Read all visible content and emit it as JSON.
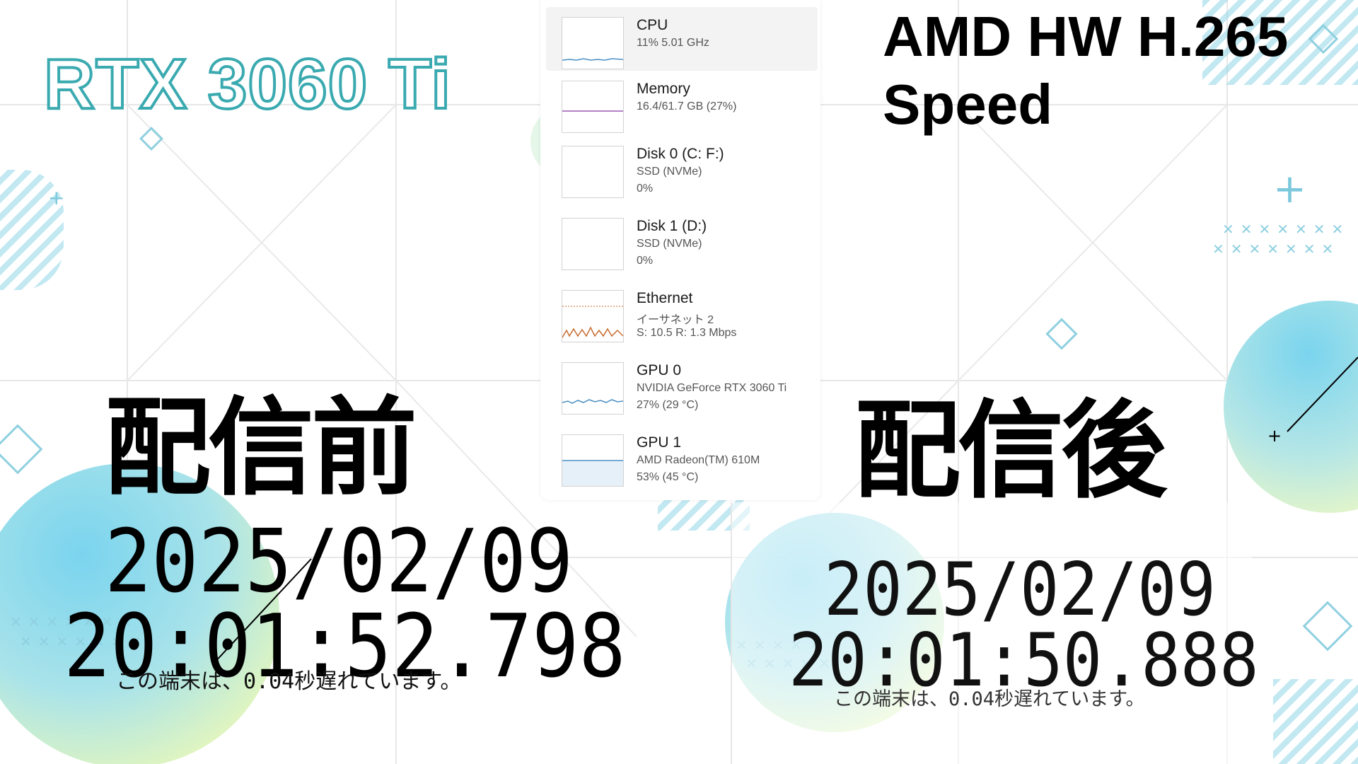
{
  "left_panel": {
    "gpu_title": "RTX 3060 Ti",
    "state_label": "配信前",
    "date": "2025/02/09",
    "time": "20:01:52.798",
    "delay_text": "この端末は、0.04秒遅れています。"
  },
  "right_panel": {
    "encoder_title_line1": "AMD HW H.265",
    "encoder_title_line2": "Speed",
    "state_label": "配信後",
    "date": "2025/02/09",
    "time": "20:01:50.888",
    "delay_text": "この端末は、0.04秒遅れています。"
  },
  "task_manager": {
    "items": [
      {
        "name": "CPU",
        "line1": "11%  5.01 GHz",
        "line2": "",
        "selected": true,
        "graph_color": "#4a8fc4"
      },
      {
        "name": "Memory",
        "line1": "16.4/61.7 GB (27%)",
        "line2": "",
        "selected": false,
        "graph_color": "#9b59b6"
      },
      {
        "name": "Disk 0 (C: F:)",
        "line1": "SSD (NVMe)",
        "line2": "0%",
        "selected": false,
        "graph_color": "#4caf50"
      },
      {
        "name": "Disk 1 (D:)",
        "line1": "SSD (NVMe)",
        "line2": "0%",
        "selected": false,
        "graph_color": "#4caf50"
      },
      {
        "name": "Ethernet",
        "line1": "イーサネット 2",
        "line2": "S: 10.5  R: 1.3 Mbps",
        "selected": false,
        "graph_color": "#c86a2c"
      },
      {
        "name": "GPU 0",
        "line1": "NVIDIA GeForce RTX 3060 Ti",
        "line2": "27%  (29 °C)",
        "selected": false,
        "graph_color": "#4a8fc4"
      },
      {
        "name": "GPU 1",
        "line1": "AMD Radeon(TM) 610M",
        "line2": "53%  (45 °C)",
        "selected": false,
        "graph_color": "#4a8fc4"
      }
    ]
  },
  "colors": {
    "accent_teal": "#3aaab0",
    "bg_blob_blue": "#7ad4ee",
    "bg_blob_green": "#d8f2b8"
  }
}
